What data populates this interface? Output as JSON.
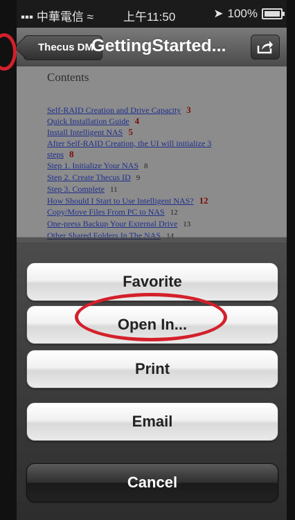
{
  "status_bar": {
    "carrier": "中華電信",
    "time": "上午11:50",
    "battery": "100%"
  },
  "nav": {
    "back_label": "Thecus DM",
    "title": "GettingStarted..."
  },
  "document": {
    "heading": "Contents",
    "toc": [
      {
        "label": "Self-RAID Creation and Drive Capacity",
        "page": "3",
        "style": "red"
      },
      {
        "label": "Quick Installation Guide",
        "page": "4",
        "style": "red"
      },
      {
        "label": "Install Intelligent NAS",
        "page": "5",
        "style": "red"
      },
      {
        "label": "After Self-RAID Creation, the UI will initialize 3",
        "page": "",
        "style": "red"
      },
      {
        "label": "steps",
        "page": "8",
        "style": "red"
      },
      {
        "label": "Step 1. Initialize Your NAS",
        "page": "8",
        "style": "black"
      },
      {
        "label": "Step 2. Create Thecus ID",
        "page": "9",
        "style": "black"
      },
      {
        "label": "Step 3. Complete",
        "page": "11",
        "style": "black"
      },
      {
        "label": "How Should I Start to Use Intelligent NAS?",
        "page": "12",
        "style": "red"
      },
      {
        "label": "Copy/Move Files From PC to NAS",
        "page": "12",
        "style": "black"
      },
      {
        "label": "One-press Backup Your External Drive",
        "page": "13",
        "style": "black"
      },
      {
        "label": "Other Shared Folders In The NAS",
        "page": "14",
        "style": "black"
      }
    ]
  },
  "action_sheet": {
    "favorite": "Favorite",
    "open_in": "Open In...",
    "print": "Print",
    "email": "Email",
    "cancel": "Cancel"
  },
  "colors": {
    "highlight_circle": "#d4202a",
    "link": "#1d2e8c",
    "page_number_red": "#7a0b0b"
  }
}
